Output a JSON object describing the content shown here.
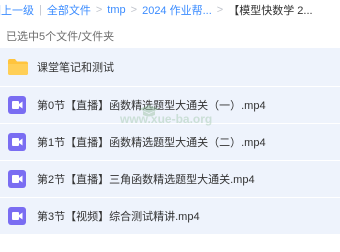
{
  "breadcrumb": {
    "items": [
      "回上一级",
      "全部文件",
      "tmp",
      "2024 作业帮...",
      "【模型快数学 2..."
    ],
    "separator": "|",
    "chevron": ">"
  },
  "selection": {
    "text": "已选中5个文件/文件夹"
  },
  "files": [
    {
      "name": "课堂笔记和测试",
      "icon": "folder-icon",
      "type": "folder"
    },
    {
      "name": "第0节【直播】函数精选题型大通关（一）.mp4",
      "icon": "video-icon",
      "type": "video"
    },
    {
      "name": "第1节【直播】函数精选题型大通关（二）.mp4",
      "icon": "video-icon",
      "type": "video"
    },
    {
      "name": "第2节【直播】三角函数精选题型大通关.mp4",
      "icon": "video-icon",
      "type": "video"
    },
    {
      "name": "第3节【视频】综合测试精讲.mp4",
      "icon": "video-icon",
      "type": "video"
    }
  ],
  "watermark": {
    "text": "www.xue-ba.org"
  },
  "colors": {
    "link": "#3b8cff",
    "row_selected_bg": "#eef3fc",
    "folder": "#ffc43d",
    "video": "#7a6df2"
  }
}
